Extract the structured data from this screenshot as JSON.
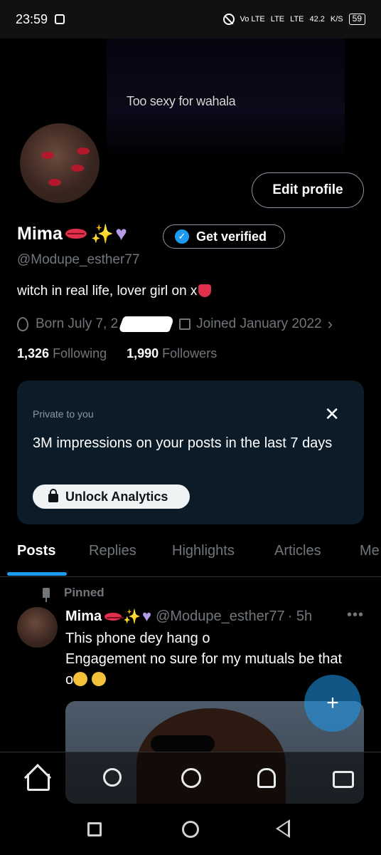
{
  "status_bar": {
    "time": "23:59",
    "network_label": "Vo LTE",
    "lte1": "LTE",
    "lte2": "LTE",
    "speed": "42.2",
    "speed_unit": "K/S",
    "battery": "59"
  },
  "banner": {
    "caption": "Too sexy for wahala"
  },
  "profile": {
    "edit_label": "Edit profile",
    "display_name": "Mima",
    "get_verified_label": "Get verified",
    "handle": "@Modupe_esther77",
    "bio": "witch in real life, lover girl on x",
    "born_prefix": "Born July 7, 2",
    "joined": "Joined January 2022",
    "following_count": "1,326",
    "following_label": "Following",
    "followers_count": "1,990",
    "followers_label": "Followers"
  },
  "analytics_card": {
    "private_label": "Private to you",
    "close_glyph": "✕",
    "title": "3M impressions on your posts in the last 7 days",
    "button_label": "Unlock Analytics"
  },
  "tabs": [
    {
      "label": "Posts",
      "active": true
    },
    {
      "label": "Replies",
      "active": false
    },
    {
      "label": "Highlights",
      "active": false
    },
    {
      "label": "Articles",
      "active": false
    },
    {
      "label": "Me",
      "active": false
    }
  ],
  "pinned_post": {
    "pinned_label": "Pinned",
    "author": "Mima",
    "handle": "@Modupe_esther77",
    "time": "· 5h",
    "more_glyph": "•••",
    "line1": "This phone dey hang o",
    "line2": "Engagement no sure for my mutuals be that",
    "line3": "o"
  },
  "fab_glyph": "+",
  "colors": {
    "accent": "#1d9bf0",
    "card_bg": "#0b1c28",
    "muted_text": "#71767b"
  },
  "icons": {
    "nav": [
      "home-icon",
      "search-icon",
      "grok-icon",
      "notifications-icon",
      "messages-icon"
    ],
    "system": [
      "recents-icon",
      "home-system-icon",
      "back-icon"
    ]
  }
}
